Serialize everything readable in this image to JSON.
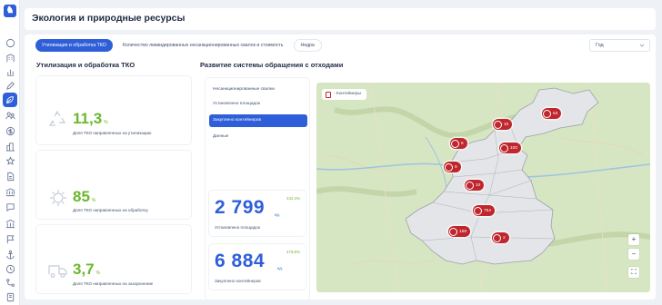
{
  "header": {
    "title": "Экология и природные ресурсы"
  },
  "tabs": [
    {
      "label": "Утилизация и обработка ТКО",
      "active": true
    },
    {
      "label": "Количество ликвидированных несанкционированных свалок и стоимость",
      "active": false
    },
    {
      "label": "Недра",
      "active": false
    }
  ],
  "year_select": {
    "value": "Год"
  },
  "left_section": {
    "title": "Утилизация и обработка ТКО",
    "kpis": [
      {
        "value": "11,3",
        "unit": "%",
        "label": "Доля ТКО направленных на утилизацию",
        "icon": "recycle-icon"
      },
      {
        "value": "85",
        "unit": "%",
        "label": "Доля ТКО направленных на обработку",
        "icon": "processing-icon"
      },
      {
        "value": "3,7",
        "unit": "%",
        "label": "Доля ТКО направленных на захоронение",
        "icon": "truck-icon"
      }
    ]
  },
  "right_section": {
    "title": "Развитие системы обращения с отходами",
    "menu": [
      {
        "label": "Несанкционированные свалки",
        "active": false
      },
      {
        "label": "Установлено площадок",
        "active": false
      },
      {
        "label": "Закуплено контейнеров",
        "active": true
      },
      {
        "label": "Данные",
        "active": false
      }
    ],
    "stats": [
      {
        "value": "2 799",
        "unit": "ед.",
        "delta": "442,4%",
        "label": "Установлено площадок"
      },
      {
        "value": "6 884",
        "unit": "ед.",
        "delta": "479,5%",
        "label": "Закуплено контейнеров"
      }
    ],
    "map": {
      "legend": "- Контейнеры",
      "markers": [
        "63",
        "10",
        "5",
        "100",
        "9",
        "10",
        "75л",
        "158",
        "2"
      ],
      "zoom_in": "+",
      "zoom_out": "−",
      "fullscreen": "⛶"
    }
  },
  "colors": {
    "accent": "#2f5fd8",
    "kpi_green": "#6ab82e",
    "marker_red": "#c0262d"
  }
}
